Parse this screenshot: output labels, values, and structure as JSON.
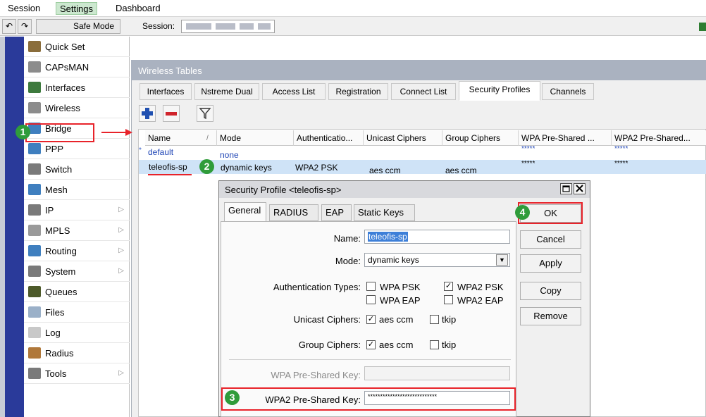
{
  "menu": [
    "Session",
    "Settings",
    "Dashboard"
  ],
  "toolbar": {
    "undo": "↶",
    "redo": "↷",
    "safe_mode": "Safe Mode",
    "session_label": "Session:"
  },
  "sidebar": {
    "items": [
      {
        "label": "Quick Set",
        "icon": "wand-icon",
        "color": "#8a6d3b",
        "submenu": false
      },
      {
        "label": "CAPsMAN",
        "icon": "antenna-icon",
        "color": "#8c8c8c",
        "submenu": false
      },
      {
        "label": "Interfaces",
        "icon": "interfaces-icon",
        "color": "#3d7a3d",
        "submenu": false
      },
      {
        "label": "Wireless",
        "icon": "antenna-icon",
        "color": "#8c8c8c",
        "submenu": false
      },
      {
        "label": "Bridge",
        "icon": "bridge-icon",
        "color": "#3f7fbf",
        "submenu": false
      },
      {
        "label": "PPP",
        "icon": "ppp-icon",
        "color": "#3f7fbf",
        "submenu": false
      },
      {
        "label": "Switch",
        "icon": "switch-icon",
        "color": "#7a7a7a",
        "submenu": false
      },
      {
        "label": "Mesh",
        "icon": "mesh-icon",
        "color": "#3f7fbf",
        "submenu": false
      },
      {
        "label": "IP",
        "icon": "ip-icon",
        "color": "#7a7a7a",
        "submenu": true
      },
      {
        "label": "MPLS",
        "icon": "mpls-icon",
        "color": "#9a9a9a",
        "submenu": true
      },
      {
        "label": "Routing",
        "icon": "routing-icon",
        "color": "#3f7fbf",
        "submenu": true
      },
      {
        "label": "System",
        "icon": "gear-icon",
        "color": "#7a7a7a",
        "submenu": true
      },
      {
        "label": "Queues",
        "icon": "queues-icon",
        "color": "#4d5a2a",
        "submenu": false
      },
      {
        "label": "Files",
        "icon": "folder-icon",
        "color": "#9ab0c8",
        "submenu": false
      },
      {
        "label": "Log",
        "icon": "log-icon",
        "color": "#c8c8c8",
        "submenu": false
      },
      {
        "label": "Radius",
        "icon": "radius-icon",
        "color": "#b0783a",
        "submenu": false
      },
      {
        "label": "Tools",
        "icon": "tools-icon",
        "color": "#7a7a7a",
        "submenu": true
      }
    ]
  },
  "wireless_tables": {
    "title": "Wireless Tables",
    "tabs": [
      "Interfaces",
      "Nstreme Dual",
      "Access List",
      "Registration",
      "Connect List",
      "Security Profiles",
      "Channels"
    ],
    "active_tab": "Security Profiles",
    "columns": [
      "Name",
      "Mode",
      "Authenticatio...",
      "Unicast Ciphers",
      "Group Ciphers",
      "WPA Pre-Shared ...",
      "WPA2 Pre-Shared..."
    ],
    "rows": [
      {
        "marker": "*",
        "name": "default",
        "mode": "none",
        "auth": "",
        "unicast": "",
        "group": "",
        "wpa": "*****",
        "wpa2": "*****"
      },
      {
        "marker": "",
        "name": "teleofis-sp",
        "mode": "dynamic keys",
        "auth": "WPA2 PSK",
        "unicast": "aes ccm",
        "group": "aes ccm",
        "wpa": "*****",
        "wpa2": "*****"
      }
    ]
  },
  "dialog": {
    "title": "Security Profile <teleofis-sp>",
    "tabs": [
      "General",
      "RADIUS",
      "EAP",
      "Static Keys"
    ],
    "active_tab": "General",
    "fields": {
      "name_label": "Name:",
      "name_value": "teleofis-sp",
      "mode_label": "Mode:",
      "mode_value": "dynamic keys",
      "auth_label": "Authentication Types:",
      "wpa_psk": "WPA PSK",
      "wpa2_psk": "WPA2 PSK",
      "wpa_eap": "WPA EAP",
      "wpa2_eap": "WPA2 EAP",
      "unicast_label": "Unicast Ciphers:",
      "group_label": "Group Ciphers:",
      "aes_ccm": "aes ccm",
      "tkip": "tkip",
      "wpa_key_label": "WPA Pre-Shared Key:",
      "wpa_key_value": "",
      "wpa2_key_label": "WPA2 Pre-Shared Key:",
      "wpa2_key_value": "****************************"
    },
    "checks": {
      "wpa_psk": false,
      "wpa2_psk": true,
      "wpa_eap": false,
      "wpa2_eap": false,
      "uni_aes": true,
      "uni_tkip": false,
      "grp_aes": true,
      "grp_tkip": false
    },
    "buttons": [
      "OK",
      "Cancel",
      "Apply",
      "Copy",
      "Remove"
    ]
  },
  "annotations": [
    "1",
    "2",
    "3",
    "4"
  ],
  "colors": {
    "accent_red": "#e8232a",
    "badge_green": "#2f9c3a",
    "selected_row": "#cfe3f7",
    "sidebar_blue": "#2a3a9a"
  }
}
